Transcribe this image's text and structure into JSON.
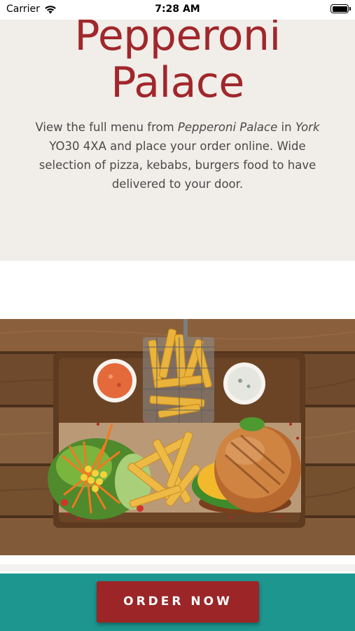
{
  "status_bar": {
    "carrier": "Carrier",
    "time": "7:28 AM",
    "icons": [
      "wifi-icon",
      "battery-icon"
    ]
  },
  "hero": {
    "title_line1": "Pepperoni",
    "title_line2": "Palace",
    "desc_part1": "View the full menu from ",
    "desc_restaurant": "Pepperoni Palace",
    "desc_part2": " in ",
    "desc_city": "York",
    "desc_part3": " YO30 4XA and place your order online. Wide selection of pizza, kebabs, burgers food to have delivered to your door."
  },
  "order": {
    "button_label": "ORDER NOW"
  },
  "colors": {
    "brand_red": "#a0272b",
    "hero_background": "#f1ede9",
    "order_bar": "#1d9690",
    "button": "#9b2527"
  }
}
